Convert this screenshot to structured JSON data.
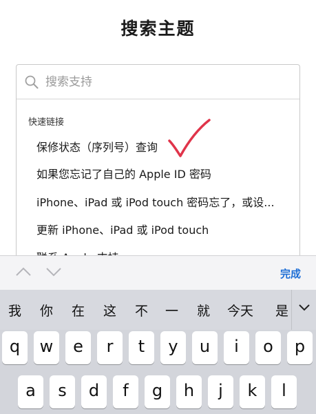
{
  "page": {
    "title": "搜索主题"
  },
  "search": {
    "placeholder": "搜索支持"
  },
  "quick_links": {
    "label": "快速链接",
    "items": [
      "保修状态（序列号）查询",
      "如果您忘记了自己的 Apple ID 密码",
      "iPhone、iPad 或 iPod touch 密码忘了，或设...",
      "更新 iPhone、iPad 或 iPod touch",
      "联系 Apple 支持"
    ]
  },
  "toolbar": {
    "done_label": "完成"
  },
  "keyboard": {
    "candidates": [
      "我",
      "你",
      "在",
      "这",
      "不",
      "一",
      "就",
      "今天",
      "是"
    ],
    "row1": [
      "q",
      "w",
      "e",
      "r",
      "t",
      "y",
      "u",
      "i",
      "o",
      "p"
    ],
    "row2": [
      "a",
      "s",
      "d",
      "f",
      "g",
      "h",
      "j",
      "k",
      "l"
    ]
  },
  "colors": {
    "accent": "#1f6fd6",
    "checkmark": "#e0344a"
  }
}
